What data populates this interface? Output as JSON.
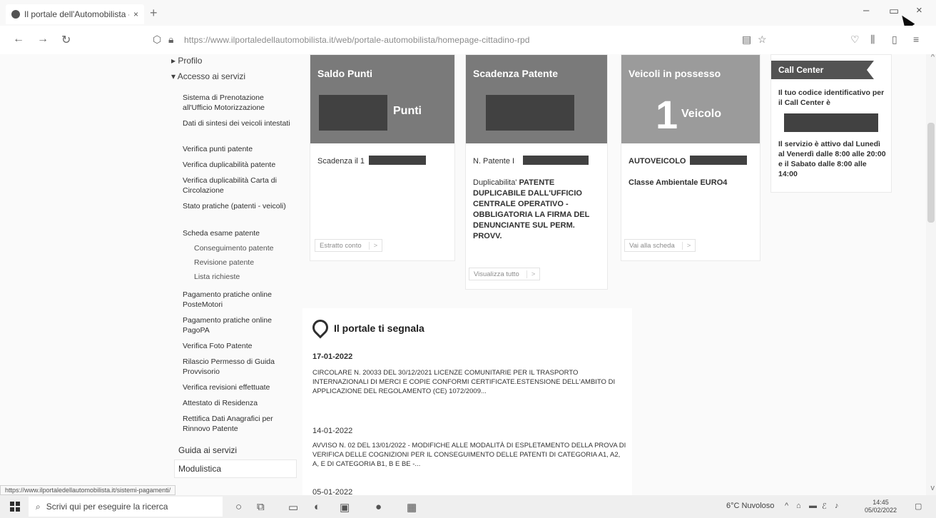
{
  "browser": {
    "tab_title": "Il portale dell'Automobilista - I",
    "tab_close": "×",
    "new_tab": "+",
    "url": "https://www.ilportaledellautomobilista.it/web/portale-automobilista/homepage-cittadino-rpd",
    "back": "←",
    "forward": "→",
    "reload": "↻",
    "minimize": "–",
    "maximize": "▭",
    "close": "×",
    "status_url": "https://www.ilportaledellautomobilista.it/sistemi-pagamenti/"
  },
  "sidebar": {
    "profilo": "▸ Profilo",
    "accesso": "▾ Accesso ai servizi",
    "items": [
      "Sistema di Prenotazione all'Ufficio Motorizzazione",
      "Dati di sintesi dei veicoli intestati",
      "Verifica punti patente",
      "Verifica duplicabilità patente",
      "Verifica duplicabilità Carta di Circolazione",
      "Stato pratiche (patenti - veicoli)",
      "Scheda esame patente"
    ],
    "sub_items": [
      "Conseguimento patente",
      "Revisione patente",
      "Lista richieste"
    ],
    "items2": [
      "Pagamento pratiche online PosteMotori",
      "Pagamento pratiche online PagoPA",
      "Verifica Foto Patente",
      "Rilascio Permesso di Guida Provvisorio",
      "Verifica revisioni effettuate",
      "Attestato di Residenza",
      "Rettifica Dati Anagrafici per Rinnovo Patente"
    ],
    "guida": "Guida ai servizi",
    "modulistica": "Modulistica"
  },
  "cards": {
    "saldo": {
      "title": "Saldo Punti",
      "unit": "Punti",
      "scadenza": "Scadenza il 1",
      "button": "Estratto conto",
      "arrow": ">"
    },
    "scadenza": {
      "title": "Scadenza Patente",
      "n_patente": "N. Patente I",
      "dup_label": "Duplicabilita'",
      "dup_value": "PATENTE DUPLICABILE DALL'UFFICIO CENTRALE OPERATIVO - OBBLIGATORIA LA FIRMA DEL DENUNCIANTE SUL PERM. PROVV.",
      "button": "Visualizza tutto",
      "arrow": ">"
    },
    "veicoli": {
      "title": "Veicoli in possesso",
      "count": "1",
      "unit": "Veicolo",
      "auto": "AUTOVEICOLO",
      "classe": "Classe Ambientale EURO4",
      "button": "Vai alla scheda",
      "arrow": ">"
    }
  },
  "callcenter": {
    "title": "Call Center",
    "intro": "Il tuo codice identificativo per il Call Center è",
    "orari": "Il servizio è attivo dal Lunedì al Venerdì dalle 8:00 alle 20:00 e il Sabato dalle 8:00 alle 14:00"
  },
  "news": {
    "title": "Il portale ti segnala",
    "items": [
      {
        "date": "17-01-2022",
        "text": "CIRCOLARE N. 20033 DEL 30/12/2021 LICENZE COMUNITARIE PER IL TRASPORTO INTERNAZIONALI DI MERCI E COPIE CONFORMI CERTIFICATE.ESTENSIONE DELL'AMBITO DI APPLICAZIONE DEL REGOLAMENTO (CE) 1072/2009..."
      },
      {
        "date": "14-01-2022",
        "text": "AVVISO N. 02 DEL 13/01/2022 - MODIFICHE ALLE MODALITÀ DI ESPLETAMENTO DELLA PROVA DI VERIFICA DELLE COGNIZIONI PER IL CONSEGUIMENTO DELLE PATENTI DI CATEGORIA A1, A2, A, E DI CATEGORIA B1, B E BE -..."
      },
      {
        "date": "05-01-2022",
        "text": ""
      }
    ]
  },
  "taskbar": {
    "search_placeholder": "Scrivi qui per eseguire la ricerca",
    "weather": "6°C Nuvoloso",
    "time": "14:45",
    "date": "05/02/2022"
  },
  "colors": {
    "card_head": "#7a7a7a",
    "card_head_light": "#9a9a9a",
    "callcenter_flag": "#555555"
  }
}
